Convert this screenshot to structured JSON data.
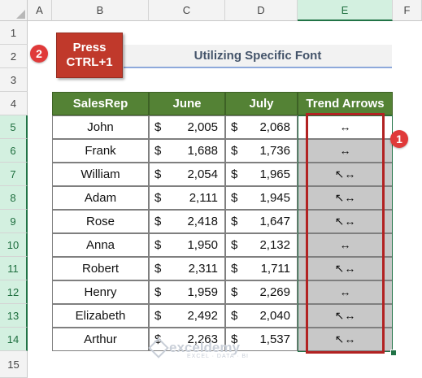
{
  "columns": [
    "A",
    "B",
    "C",
    "D",
    "E",
    "F"
  ],
  "rows": [
    "1",
    "2",
    "3",
    "4",
    "5",
    "6",
    "7",
    "8",
    "9",
    "10",
    "11",
    "12",
    "13",
    "14",
    "15"
  ],
  "title": "Utilizing Specific Font",
  "press_note": {
    "line1": "Press",
    "line2": "CTRL+1"
  },
  "badge1": "1",
  "badge2": "2",
  "table": {
    "headers": [
      "SalesRep",
      "June",
      "July",
      "Trend Arrows"
    ],
    "currency": "$",
    "rows": [
      {
        "rep": "John",
        "june": "2,005",
        "july": "2,068",
        "trend": "↔"
      },
      {
        "rep": "Frank",
        "june": "1,688",
        "july": "1,736",
        "trend": "↔"
      },
      {
        "rep": "William",
        "june": "2,054",
        "july": "1,965",
        "trend": "↖↔"
      },
      {
        "rep": "Adam",
        "june": "2,111",
        "july": "1,945",
        "trend": "↖↔"
      },
      {
        "rep": "Rose",
        "june": "2,418",
        "july": "1,647",
        "trend": "↖↔"
      },
      {
        "rep": "Anna",
        "june": "1,950",
        "july": "2,132",
        "trend": "↔"
      },
      {
        "rep": "Robert",
        "june": "2,311",
        "july": "1,711",
        "trend": "↖↔"
      },
      {
        "rep": "Henry",
        "june": "1,959",
        "july": "2,269",
        "trend": "↔"
      },
      {
        "rep": "Elizabeth",
        "june": "2,492",
        "july": "2,040",
        "trend": "↖↔"
      },
      {
        "rep": "Arthur",
        "june": "2,263",
        "july": "1,537",
        "trend": "↖↔"
      }
    ]
  },
  "selected_column": "E",
  "watermark": {
    "name": "exceldemy",
    "tagline": "EXCEL · DATA · BI"
  }
}
